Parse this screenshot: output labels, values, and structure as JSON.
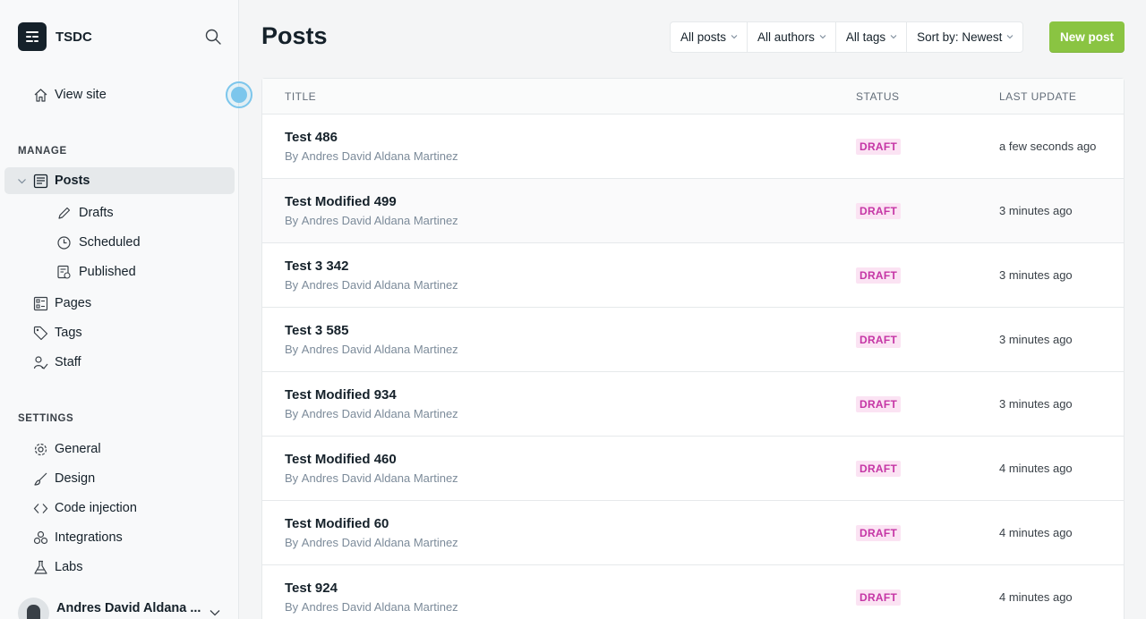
{
  "brand": {
    "name": "TSDC"
  },
  "sidebar": {
    "view_site": "View site",
    "manage_label": "MANAGE",
    "posts": "Posts",
    "drafts": "Drafts",
    "scheduled": "Scheduled",
    "published": "Published",
    "pages": "Pages",
    "tags": "Tags",
    "staff": "Staff",
    "settings_label": "SETTINGS",
    "general": "General",
    "design": "Design",
    "code_injection": "Code injection",
    "integrations": "Integrations",
    "labs": "Labs",
    "user_name": "Andres David Aldana ..."
  },
  "main": {
    "title": "Posts",
    "filters": {
      "posts": "All posts",
      "authors": "All authors",
      "tags": "All tags",
      "sort": "Sort by: Newest"
    },
    "new_post": "New post",
    "columns": {
      "title": "TITLE",
      "status": "STATUS",
      "updated": "LAST UPDATE"
    },
    "rows": [
      {
        "title": "Test 486",
        "by": "By",
        "author": "Andres David Aldana Martinez",
        "status": "DRAFT",
        "updated": "a few seconds ago"
      },
      {
        "title": "Test Modified 499",
        "by": "By",
        "author": "Andres David Aldana Martinez",
        "status": "DRAFT",
        "updated": "3 minutes ago"
      },
      {
        "title": "Test 3 342",
        "by": "By",
        "author": "Andres David Aldana Martinez",
        "status": "DRAFT",
        "updated": "3 minutes ago"
      },
      {
        "title": "Test 3 585",
        "by": "By",
        "author": "Andres David Aldana Martinez",
        "status": "DRAFT",
        "updated": "3 minutes ago"
      },
      {
        "title": "Test Modified 934",
        "by": "By",
        "author": "Andres David Aldana Martinez",
        "status": "DRAFT",
        "updated": "3 minutes ago"
      },
      {
        "title": "Test Modified 460",
        "by": "By",
        "author": "Andres David Aldana Martinez",
        "status": "DRAFT",
        "updated": "4 minutes ago"
      },
      {
        "title": "Test Modified 60",
        "by": "By",
        "author": "Andres David Aldana Martinez",
        "status": "DRAFT",
        "updated": "4 minutes ago"
      },
      {
        "title": "Test 924",
        "by": "By",
        "author": "Andres David Aldana Martinez",
        "status": "DRAFT",
        "updated": "4 minutes ago"
      }
    ]
  },
  "colors": {
    "accent": "#8ac442",
    "draft_bg": "#fbe3f3",
    "draft_text": "#c535a5",
    "pulse": "#7cc6ec"
  }
}
